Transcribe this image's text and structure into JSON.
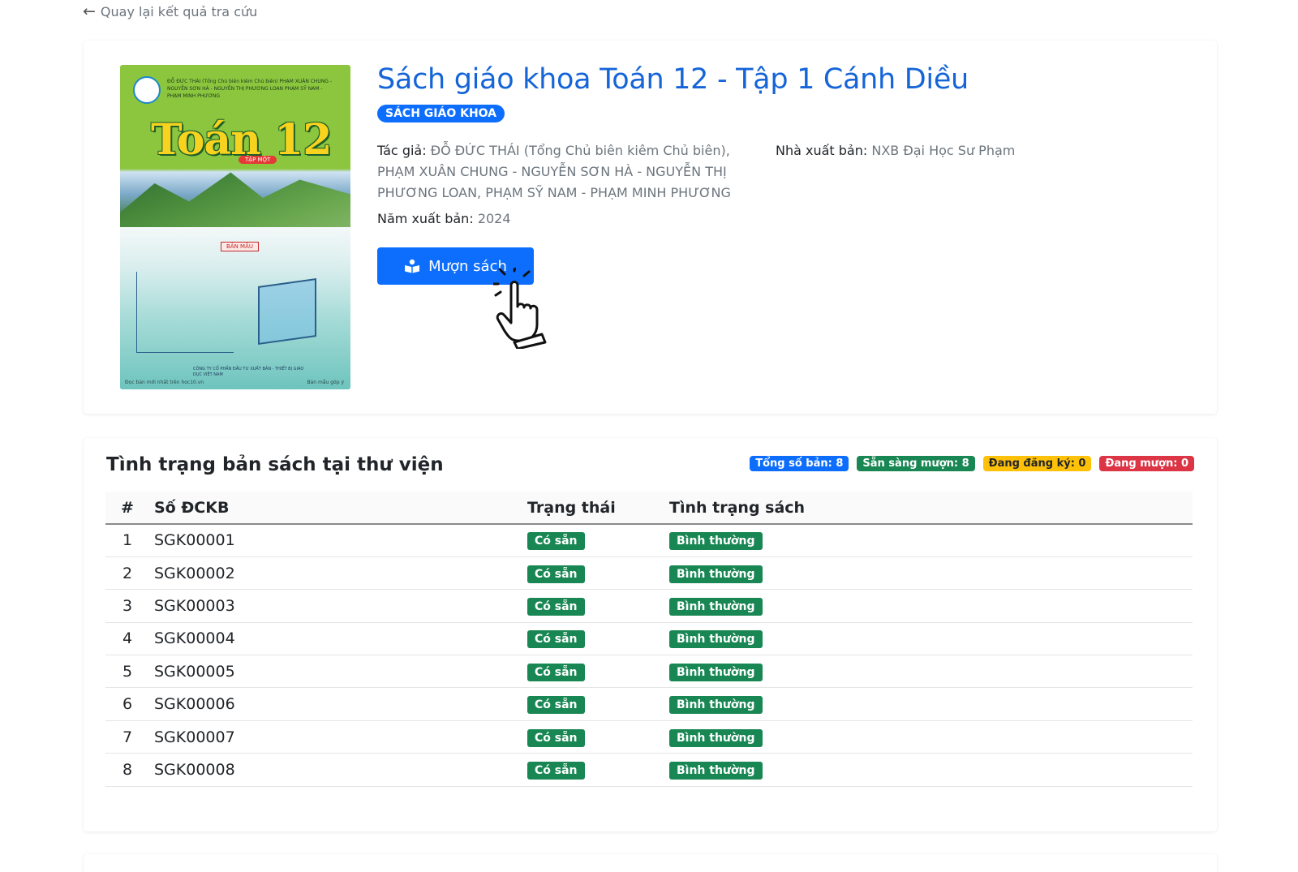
{
  "nav": {
    "back_label": "Quay lại kết quả tra cứu"
  },
  "book": {
    "title": "Sách giáo khoa Toán 12 - Tập 1 Cánh Diều",
    "type_badge": "SÁCH GIÁO KHOA",
    "author_label": "Tác giả:",
    "authors": "ĐỖ ĐỨC THÁI (Tổng Chủ biên kiêm Chủ biên), PHẠM XUÂN CHUNG - NGUYỄN SƠN HÀ - NGUYỄN THỊ PHƯƠNG LOAN, PHẠM SỸ NAM - PHẠM MINH PHƯƠNG",
    "publisher_label": "Nhà xuất bản:",
    "publisher": "NXB Đại Học Sư Phạm",
    "year_label": "Năm xuất bản:",
    "year": "2024",
    "borrow_label": "Mượn sách",
    "cover": {
      "authors_line": "ĐỖ ĐỨC THÁI (Tổng Chủ biên kiêm Chủ biên) PHẠM XUÂN CHUNG - NGUYỄN SƠN HÀ - NGUYỄN THỊ PHƯƠNG LOAN PHẠM SỸ NAM - PHẠM MINH PHƯƠNG",
      "title": "Toán 12",
      "volume": "TẬP MỘT",
      "badge": "BẢN MẪU",
      "publisher": "CÔNG TY CỔ PHẦN ĐẦU TƯ XUẤT BẢN - THIẾT BỊ GIÁO DỤC VIỆT NAM",
      "foot_left": "Đọc bản mới nhất trên hoc10.vn",
      "foot_right": "Bản mẫu góp ý"
    }
  },
  "status": {
    "title": "Tình trạng bản sách tại thư viện",
    "counts": {
      "total": "Tổng số bản: 8",
      "ready": "Sẵn sàng mượn: 8",
      "registered": "Đang đăng ký: 0",
      "borrowed": "Đang mượn: 0"
    },
    "headers": {
      "idx": "#",
      "code": "Số ĐCKB",
      "state": "Trạng thái",
      "condition": "Tình trạng sách"
    },
    "rows": [
      {
        "idx": "1",
        "code": "SGK00001",
        "state": "Có sẵn",
        "condition": "Bình thường"
      },
      {
        "idx": "2",
        "code": "SGK00002",
        "state": "Có sẵn",
        "condition": "Bình thường"
      },
      {
        "idx": "3",
        "code": "SGK00003",
        "state": "Có sẵn",
        "condition": "Bình thường"
      },
      {
        "idx": "4",
        "code": "SGK00004",
        "state": "Có sẵn",
        "condition": "Bình thường"
      },
      {
        "idx": "5",
        "code": "SGK00005",
        "state": "Có sẵn",
        "condition": "Bình thường"
      },
      {
        "idx": "6",
        "code": "SGK00006",
        "state": "Có sẵn",
        "condition": "Bình thường"
      },
      {
        "idx": "7",
        "code": "SGK00007",
        "state": "Có sẵn",
        "condition": "Bình thường"
      },
      {
        "idx": "8",
        "code": "SGK00008",
        "state": "Có sẵn",
        "condition": "Bình thường"
      }
    ]
  },
  "colors": {
    "primary": "#0d6efd",
    "success": "#198754",
    "warning": "#ffc107",
    "danger": "#dc3545",
    "title": "#1565d8"
  },
  "icons": {
    "back": "arrow-left-icon",
    "borrow": "book-open-icon",
    "cursor": "hand-pointer-icon"
  }
}
